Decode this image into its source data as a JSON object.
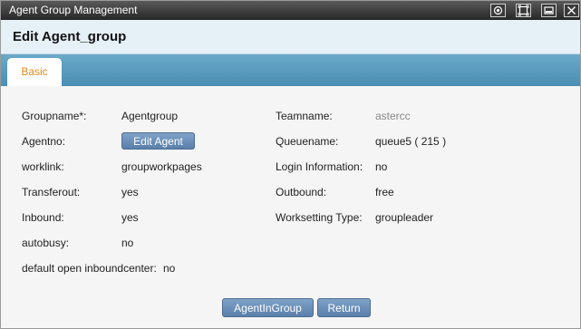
{
  "window": {
    "title": "Agent Group Management",
    "controls": [
      "restore-icon",
      "maximize-icon",
      "minimize-icon",
      "close-icon"
    ]
  },
  "header": {
    "title": "Edit Agent_group"
  },
  "tabs": [
    {
      "label": "Basic",
      "active": true
    }
  ],
  "form": {
    "groupname": {
      "label": "Groupname*:",
      "value": "Agentgroup"
    },
    "agentno": {
      "label": "Agentno:",
      "button": "Edit Agent"
    },
    "worklink": {
      "label": "worklink:",
      "value": "groupworkpages"
    },
    "transferout": {
      "label": "Transferout:",
      "value": "yes"
    },
    "inbound": {
      "label": "Inbound:",
      "value": "yes"
    },
    "autobusy": {
      "label": "autobusy:",
      "value": "no"
    },
    "default_open": {
      "label": "default open inboundcenter:",
      "value": "no"
    },
    "teamname": {
      "label": "Teamname:",
      "value": "astercc"
    },
    "queuename": {
      "label": "Queuename:",
      "value": "queue5 ( 215 )"
    },
    "login_info": {
      "label": "Login Information:",
      "value": "no"
    },
    "outbound": {
      "label": "Outbound:",
      "value": "free"
    },
    "worksetting": {
      "label": "Worksetting Type:",
      "value": "groupleader"
    }
  },
  "actions": {
    "agent_in_group": "AgentInGroup",
    "return": "Return"
  },
  "colors": {
    "tab_accent": "#e08a1e",
    "tabbar": "#4a8eb3",
    "button": "#5a7faa"
  }
}
